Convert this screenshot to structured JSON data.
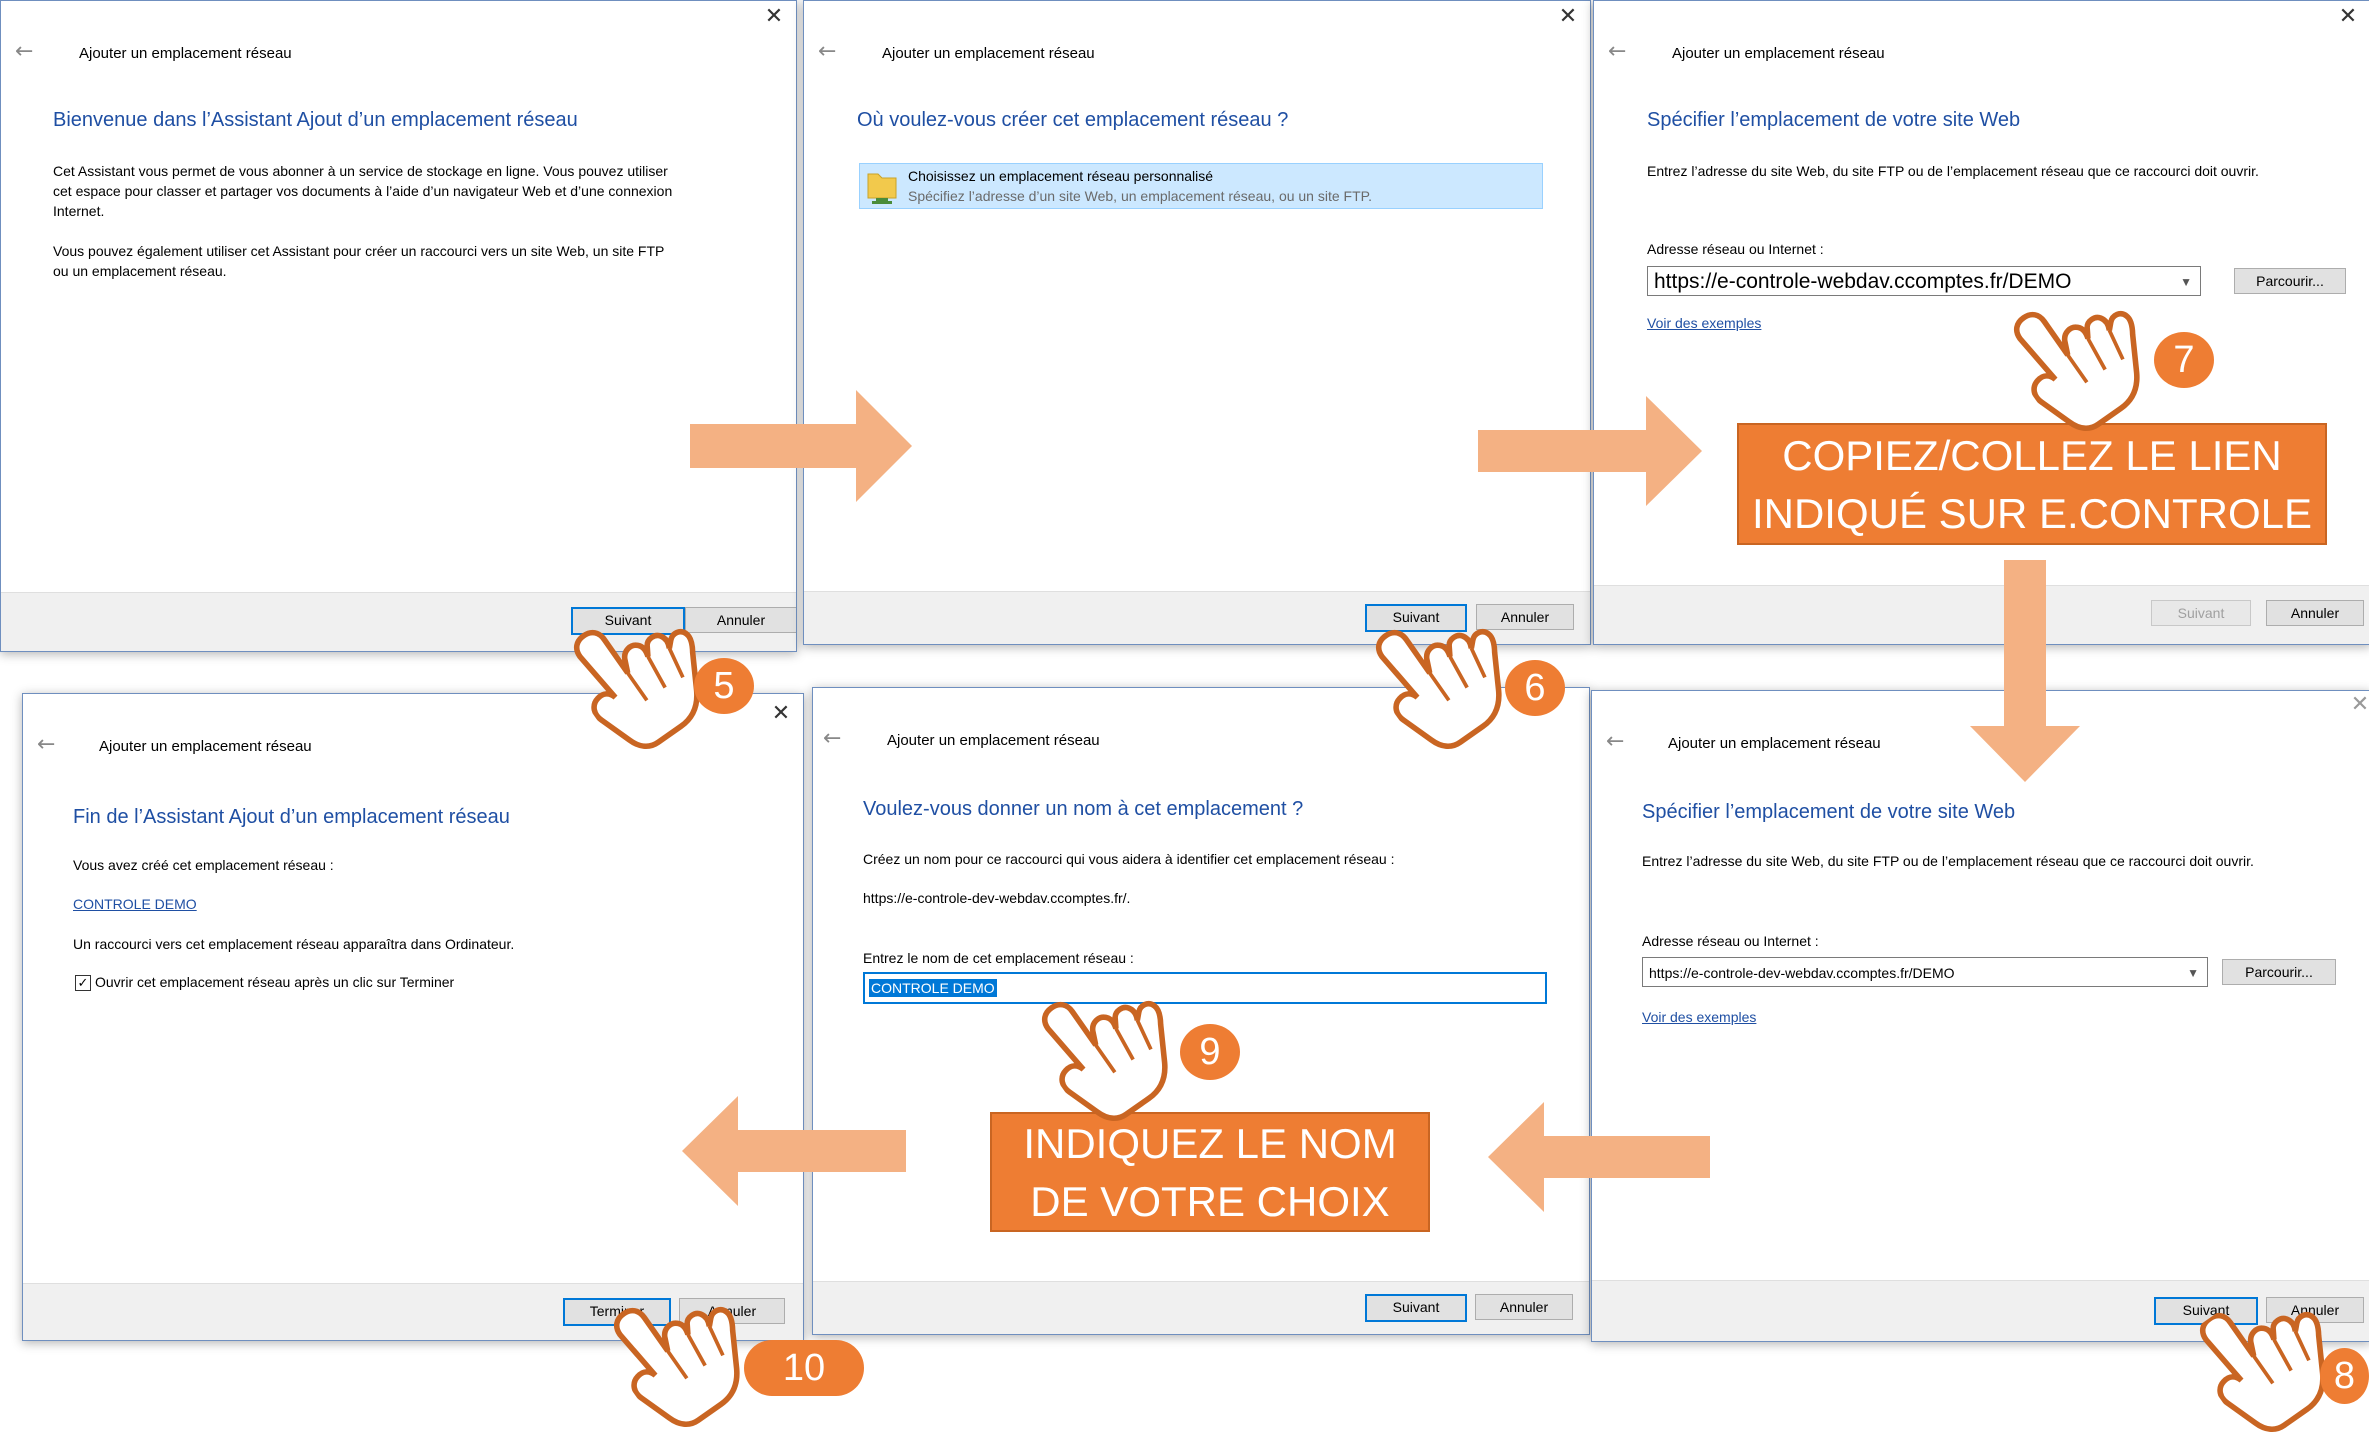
{
  "window_title": "Ajouter un emplacement réseau",
  "buttons": {
    "next": "Suivant",
    "cancel": "Annuler",
    "finish": "Terminer",
    "browse": "Parcourir..."
  },
  "d1": {
    "heading": "Bienvenue dans l’Assistant Ajout d’un emplacement réseau",
    "p1_line1": "Cet Assistant vous permet de vous abonner à un service de stockage en ligne. Vous pouvez utiliser",
    "p1_line2": "cet espace pour classer et partager vos documents à l’aide d’un navigateur Web et d’une connexion",
    "p1_line3": "Internet.",
    "p2_line1": "Vous pouvez également utiliser cet Assistant pour créer un raccourci vers un site Web, un site FTP",
    "p2_line2": "ou un emplacement réseau."
  },
  "d2": {
    "heading": "Où voulez-vous créer cet emplacement réseau ?",
    "option_title": "Choisissez un emplacement réseau personnalisé",
    "option_desc": "Spécifiez l’adresse d’un site Web, un emplacement réseau, ou un site FTP."
  },
  "d3": {
    "heading": "Spécifier l’emplacement de votre site Web",
    "desc": "Entrez l’adresse du site Web, du site FTP ou de l’emplacement réseau que ce raccourci doit ouvrir.",
    "address_label": "Adresse réseau ou Internet :",
    "address_value": "https://e-controle-webdav.ccomptes.fr/DEMO",
    "examples_link": "Voir des exemples"
  },
  "d4": {
    "heading": "Spécifier l’emplacement de votre site Web",
    "desc": "Entrez l’adresse du site Web, du site FTP ou de l’emplacement réseau que ce raccourci doit ouvrir.",
    "address_label": "Adresse réseau ou Internet :",
    "address_value": "https://e-controle-dev-webdav.ccomptes.fr/DEMO",
    "examples_link": "Voir des exemples"
  },
  "d5": {
    "heading": "Voulez-vous donner un nom à cet emplacement ?",
    "desc": "Créez un nom pour ce raccourci qui vous aidera à identifier cet emplacement réseau :",
    "url": "https://e-controle-dev-webdav.ccomptes.fr/.",
    "name_label": "Entrez le nom de cet emplacement réseau :",
    "name_value": "CONTROLE DEMO"
  },
  "d6": {
    "heading": "Fin de l’Assistant Ajout d’un emplacement réseau",
    "created_label": "Vous avez créé cet emplacement réseau :",
    "created_link": "CONTROLE DEMO",
    "shortcut_note": "Un raccourci vers cet emplacement réseau apparaîtra dans Ordinateur.",
    "open_checkbox": "Ouvrir cet emplacement réseau après un clic sur Terminer",
    "open_checked": true
  },
  "banners": {
    "copy_line1": "COPIEZ/COLLEZ LE LIEN",
    "copy_line2": "INDIQUÉ SUR E.CONTROLE",
    "name_line1": "INDIQUEZ LE NOM",
    "name_line2": "DE VOTRE CHOIX"
  },
  "steps": {
    "s5": "5",
    "s6": "6",
    "s7": "7",
    "s8": "8",
    "s9": "9",
    "s10": "10"
  },
  "colors": {
    "accent_orange": "#ee7d33",
    "arrow_orange": "#f4b183",
    "heading_blue": "#1f4fa3",
    "focus_blue": "#0078d7"
  },
  "icons": {
    "close": "close-icon",
    "back": "back-arrow-icon",
    "folder": "network-folder-icon",
    "hand": "pointing-hand-icon"
  }
}
